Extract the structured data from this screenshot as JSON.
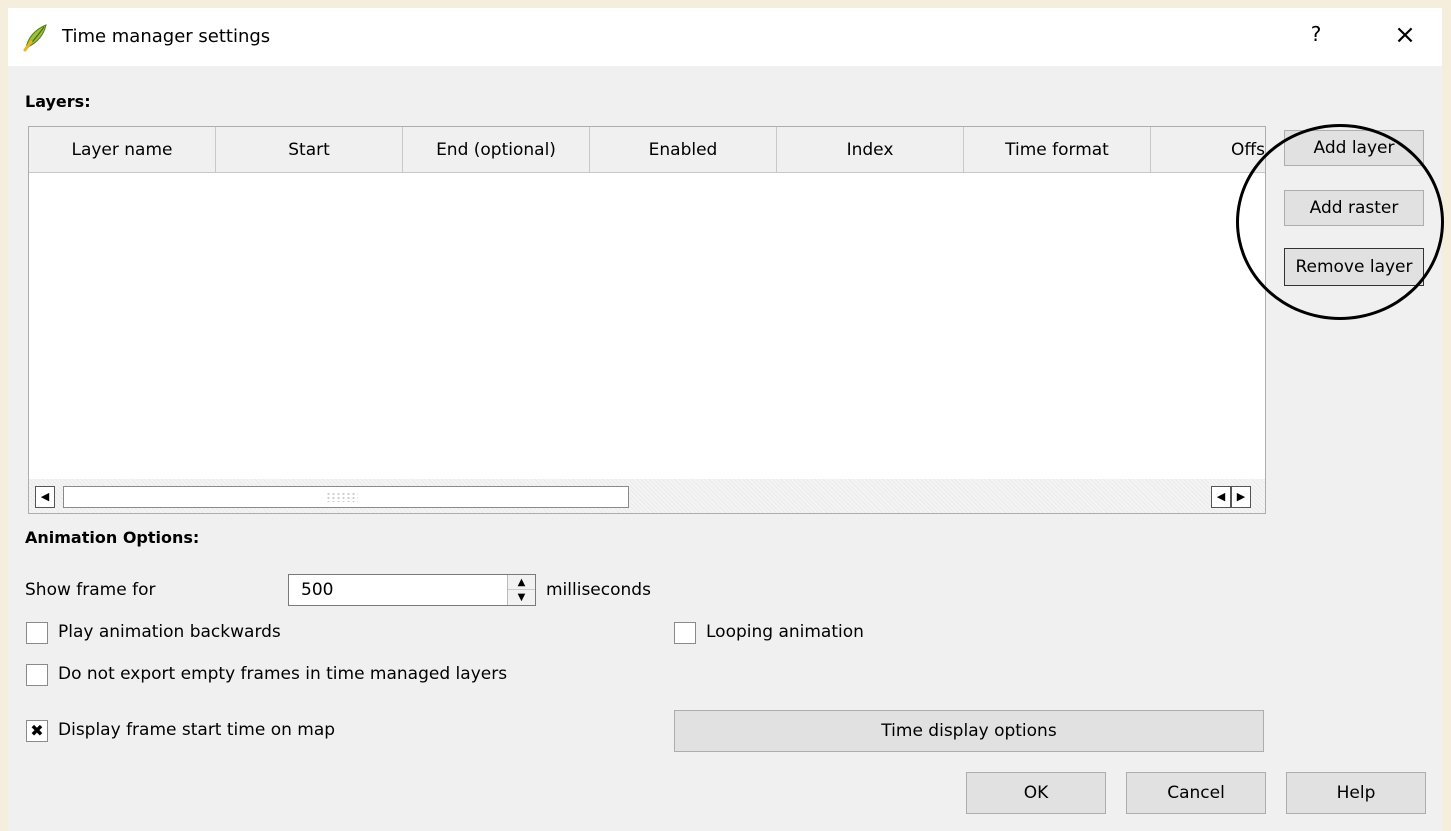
{
  "window": {
    "title": "Time manager settings",
    "help_glyph": "?",
    "close_glyph": "×"
  },
  "layers_section": {
    "label": "Layers:",
    "columns": [
      "Layer name",
      "Start",
      "End (optional)",
      "Enabled",
      "Index",
      "Time format",
      "Offs"
    ],
    "rows": [],
    "scroll_left_glyph": "◀",
    "scroll_right_glyph": "▶"
  },
  "layer_buttons": {
    "add_layer": "Add layer",
    "add_raster": "Add raster",
    "remove_layer": "Remove layer"
  },
  "animation": {
    "label": "Animation Options:",
    "show_frame_label": "Show frame for",
    "frame_value": "500",
    "frame_unit": "milliseconds",
    "spin_up_glyph": "▲",
    "spin_down_glyph": "▼",
    "play_backwards_label": "Play animation backwards",
    "play_backwards_checked": false,
    "looping_label": "Looping animation",
    "looping_checked": false,
    "no_export_empty_label": "Do not export empty frames in time managed layers",
    "no_export_empty_checked": false,
    "display_start_time_label": "Display frame start time on map",
    "display_start_time_checked": true,
    "checked_glyph": "✖",
    "time_display_options_label": "Time display options"
  },
  "footer_buttons": {
    "ok": "OK",
    "cancel": "Cancel",
    "help": "Help"
  },
  "annotation": {
    "circle_color": "#000000",
    "circle_note": "hand-drawn circle around layer buttons"
  },
  "icons": {
    "app": "qgis-leaf-icon"
  }
}
